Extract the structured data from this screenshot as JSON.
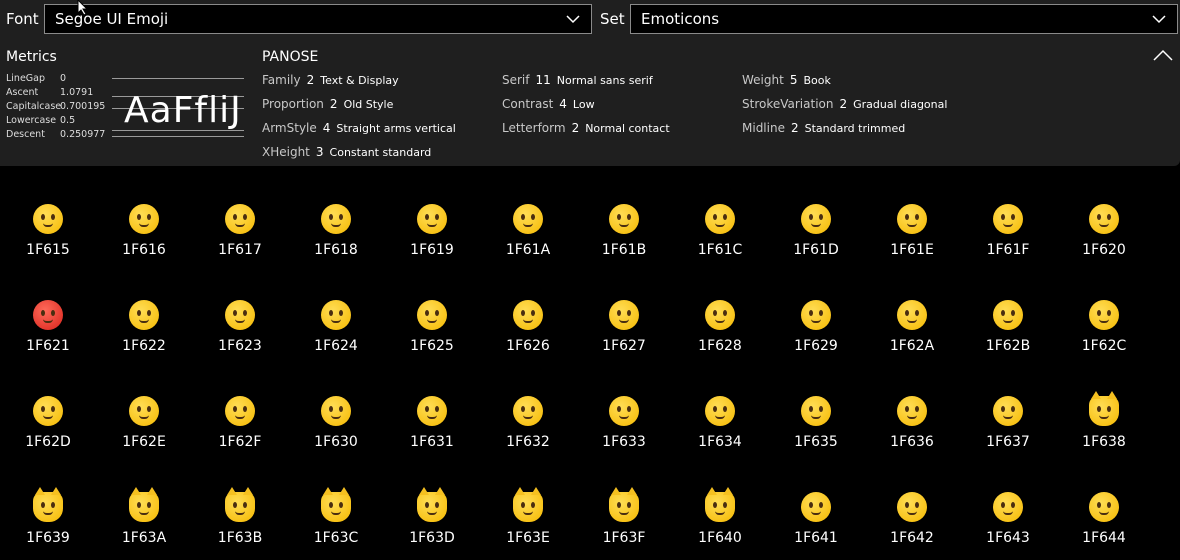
{
  "toolbar": {
    "font_label": "Font",
    "font_value": "Segoe UI Emoji",
    "set_label": "Set",
    "set_value": "Emoticons"
  },
  "metrics": {
    "title": "Metrics",
    "rows": [
      {
        "key": "LineGap",
        "value": "0"
      },
      {
        "key": "Ascent",
        "value": "1.0791"
      },
      {
        "key": "Capitalcase",
        "value": "0.700195"
      },
      {
        "key": "Lowercase",
        "value": "0.5"
      },
      {
        "key": "Descent",
        "value": "0.250977"
      }
    ],
    "sample": "AaFfliJ"
  },
  "panose": {
    "title": "PANOSE",
    "col1": [
      {
        "name": "Family",
        "num": "2",
        "desc": "Text & Display"
      },
      {
        "name": "Proportion",
        "num": "2",
        "desc": "Old Style"
      },
      {
        "name": "ArmStyle",
        "num": "4",
        "desc": "Straight arms vertical"
      },
      {
        "name": "XHeight",
        "num": "3",
        "desc": "Constant standard"
      }
    ],
    "col2": [
      {
        "name": "Serif",
        "num": "11",
        "desc": "Normal sans serif"
      },
      {
        "name": "Contrast",
        "num": "4",
        "desc": "Low"
      },
      {
        "name": "Letterform",
        "num": "2",
        "desc": "Normal contact"
      }
    ],
    "col3": [
      {
        "name": "Weight",
        "num": "5",
        "desc": "Book"
      },
      {
        "name": "StrokeVariation",
        "num": "2",
        "desc": "Gradual diagonal"
      },
      {
        "name": "Midline",
        "num": "2",
        "desc": "Standard trimmed"
      }
    ]
  },
  "glyphs": [
    "1F615",
    "1F616",
    "1F617",
    "1F618",
    "1F619",
    "1F61A",
    "1F61B",
    "1F61C",
    "1F61D",
    "1F61E",
    "1F61F",
    "1F620",
    "1F621",
    "1F622",
    "1F623",
    "1F624",
    "1F625",
    "1F626",
    "1F627",
    "1F628",
    "1F629",
    "1F62A",
    "1F62B",
    "1F62C",
    "1F62D",
    "1F62E",
    "1F62F",
    "1F630",
    "1F631",
    "1F632",
    "1F633",
    "1F634",
    "1F635",
    "1F636",
    "1F637",
    "1F638",
    "1F639",
    "1F63A",
    "1F63B",
    "1F63C",
    "1F63D",
    "1F63E",
    "1F63F",
    "1F640",
    "1F641",
    "1F642",
    "1F643",
    "1F644"
  ],
  "colors": {
    "panel_bg": "#1f1f1f",
    "grid_bg": "#000000",
    "emoji_yellow": "#f5b800",
    "emoji_red": "#d8231b"
  }
}
